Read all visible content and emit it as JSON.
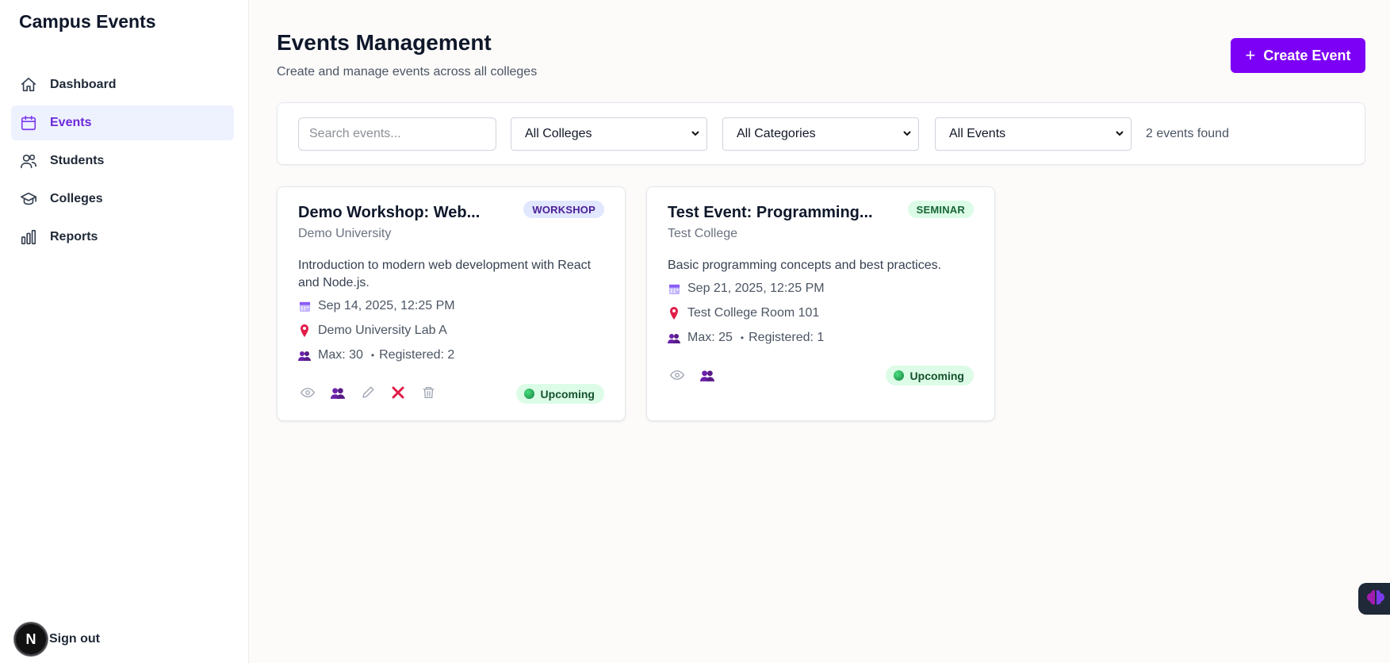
{
  "app": {
    "title": "Campus Events"
  },
  "sidebar": {
    "items": [
      {
        "label": "Dashboard",
        "icon": "home-icon"
      },
      {
        "label": "Events",
        "icon": "calendar-icon",
        "active": true
      },
      {
        "label": "Students",
        "icon": "users-icon"
      },
      {
        "label": "Colleges",
        "icon": "graduation-cap-icon"
      },
      {
        "label": "Reports",
        "icon": "bar-chart-icon"
      }
    ],
    "avatar_letter": "N",
    "signout_label": "Sign out"
  },
  "header": {
    "title": "Events Management",
    "subtitle": "Create and manage events across all colleges",
    "create_label": "Create Event"
  },
  "filters": {
    "search_placeholder": "Search events...",
    "college": "All Colleges",
    "category": "All Categories",
    "status": "All Events",
    "count_text": "2 events found"
  },
  "events": [
    {
      "title": "Demo Workshop: Web...",
      "category": "WORKSHOP",
      "college": "Demo University",
      "description": "Introduction to modern web development with React and Node.js.",
      "date": "Sep 14, 2025, 12:25 PM",
      "location": "Demo University Lab A",
      "max": "Max: 30",
      "registered": "Registered: 2",
      "status": "Upcoming"
    },
    {
      "title": "Test Event: Programming...",
      "category": "SEMINAR",
      "college": "Test College",
      "description": "Basic programming concepts and best practices.",
      "date": "Sep 21, 2025, 12:25 PM",
      "location": "Test College Room 101",
      "max": "Max: 25",
      "registered": "Registered: 1",
      "status": "Upcoming"
    }
  ],
  "colors": {
    "accent": "#7c00f5",
    "active_nav_bg": "#eef2ff",
    "status_bg": "#dcfce7",
    "workshop_badge_bg": "#e0e7ff",
    "seminar_badge_bg": "#dcfce7"
  }
}
